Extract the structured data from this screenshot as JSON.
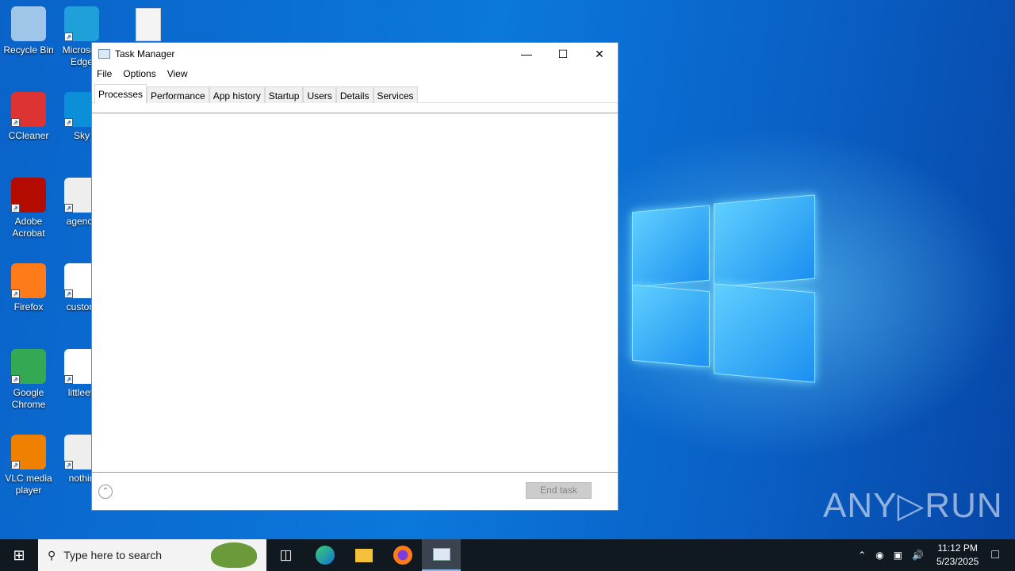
{
  "desktop": {
    "icons": [
      {
        "label": "Recycle Bin",
        "icon": "recycle-bin-icon",
        "color": "#9fc6e8"
      },
      {
        "label": "CCleaner",
        "icon": "ccleaner-icon",
        "color": "#d33"
      },
      {
        "label": "Adobe Acrobat",
        "icon": "acrobat-icon",
        "color": "#b30b00"
      },
      {
        "label": "Firefox",
        "icon": "firefox-icon",
        "color": "#ff7a18"
      },
      {
        "label": "Google Chrome",
        "icon": "chrome-icon",
        "color": "#34a853"
      },
      {
        "label": "VLC media player",
        "icon": "vlc-icon",
        "color": "#f08000"
      },
      {
        "label": "Microsoft Edge",
        "icon": "edge-icon",
        "color": "#1fa0d8"
      },
      {
        "label": "Sky",
        "icon": "skype-icon",
        "color": "#0a8fd8"
      },
      {
        "label": "agency",
        "icon": "image-file-icon",
        "color": "#eeeeee"
      },
      {
        "label": "custom",
        "icon": "word-file-icon",
        "color": "#ffffff"
      },
      {
        "label": "littleeff",
        "icon": "word-file-icon",
        "color": "#ffffff"
      },
      {
        "label": "nothin",
        "icon": "image-file-icon",
        "color": "#eeeeee"
      }
    ],
    "top_file": "image-file-icon"
  },
  "window": {
    "title": "Task Manager",
    "menu": [
      "File",
      "Options",
      "View"
    ],
    "tabs": [
      "Processes",
      "Performance",
      "App history",
      "Startup",
      "Users",
      "Details",
      "Services"
    ],
    "active_tab": "Processes",
    "end_task": "End task",
    "fewer_details": "fewer-details-icon"
  },
  "taskbar": {
    "search_placeholder": "Type here to search",
    "time": "11:12 PM",
    "date": "5/23/2025"
  },
  "watermark": "ANY▷RUN"
}
